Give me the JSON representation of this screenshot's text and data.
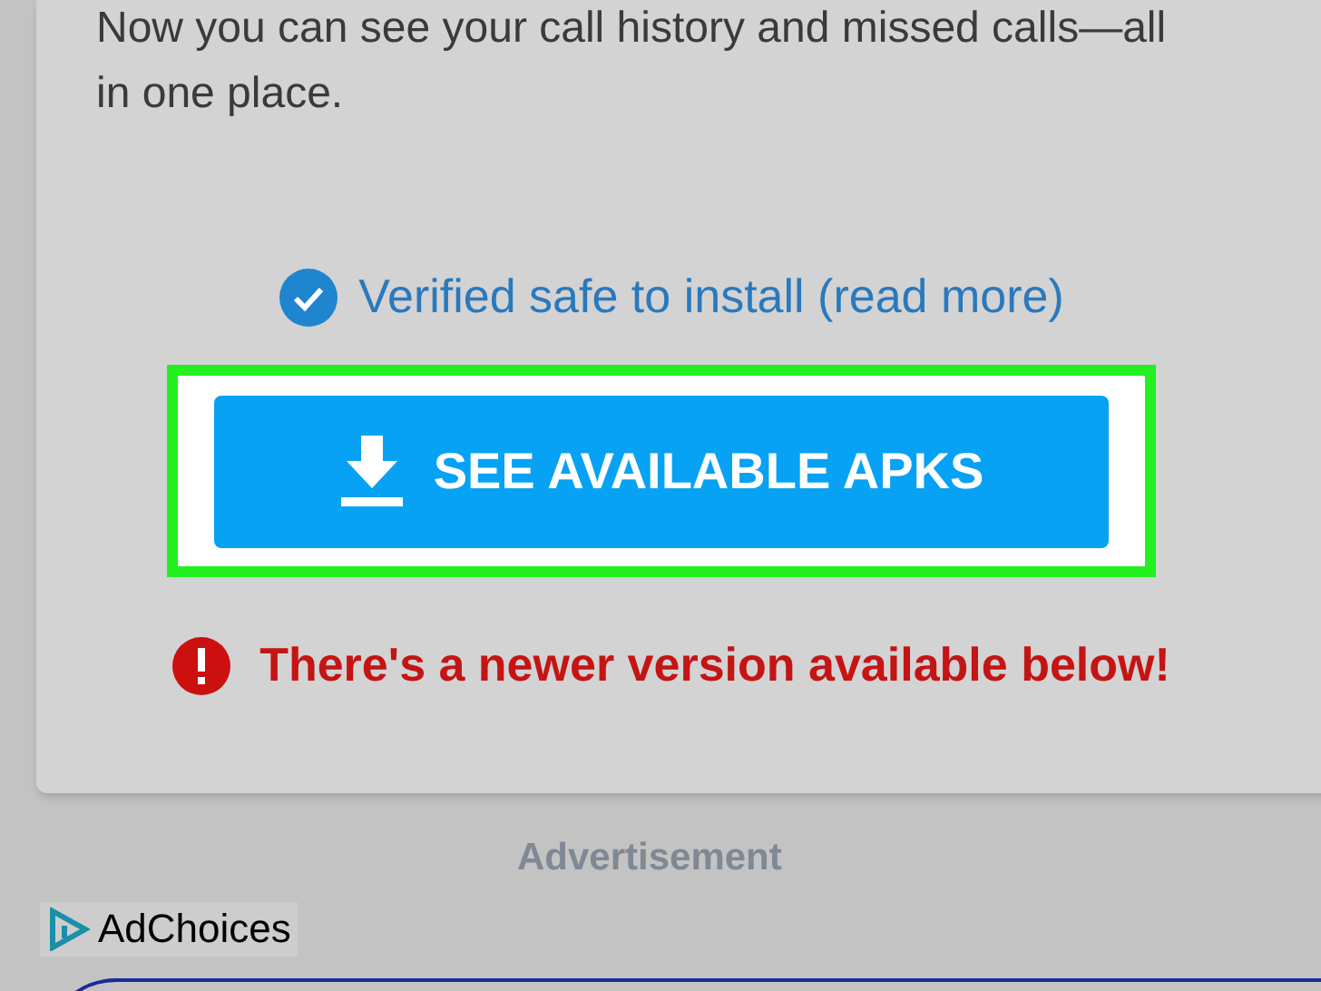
{
  "card": {
    "description": "Now you can see your call history and missed calls—all in one place.",
    "verified": {
      "text": "Verified safe to install",
      "link": "(read more)"
    },
    "download_button": {
      "label": "SEE AVAILABLE APKS",
      "highlighted": true
    },
    "warning": "There's a newer version available below!"
  },
  "ad": {
    "label": "Advertisement",
    "adchoices": "AdChoices"
  }
}
